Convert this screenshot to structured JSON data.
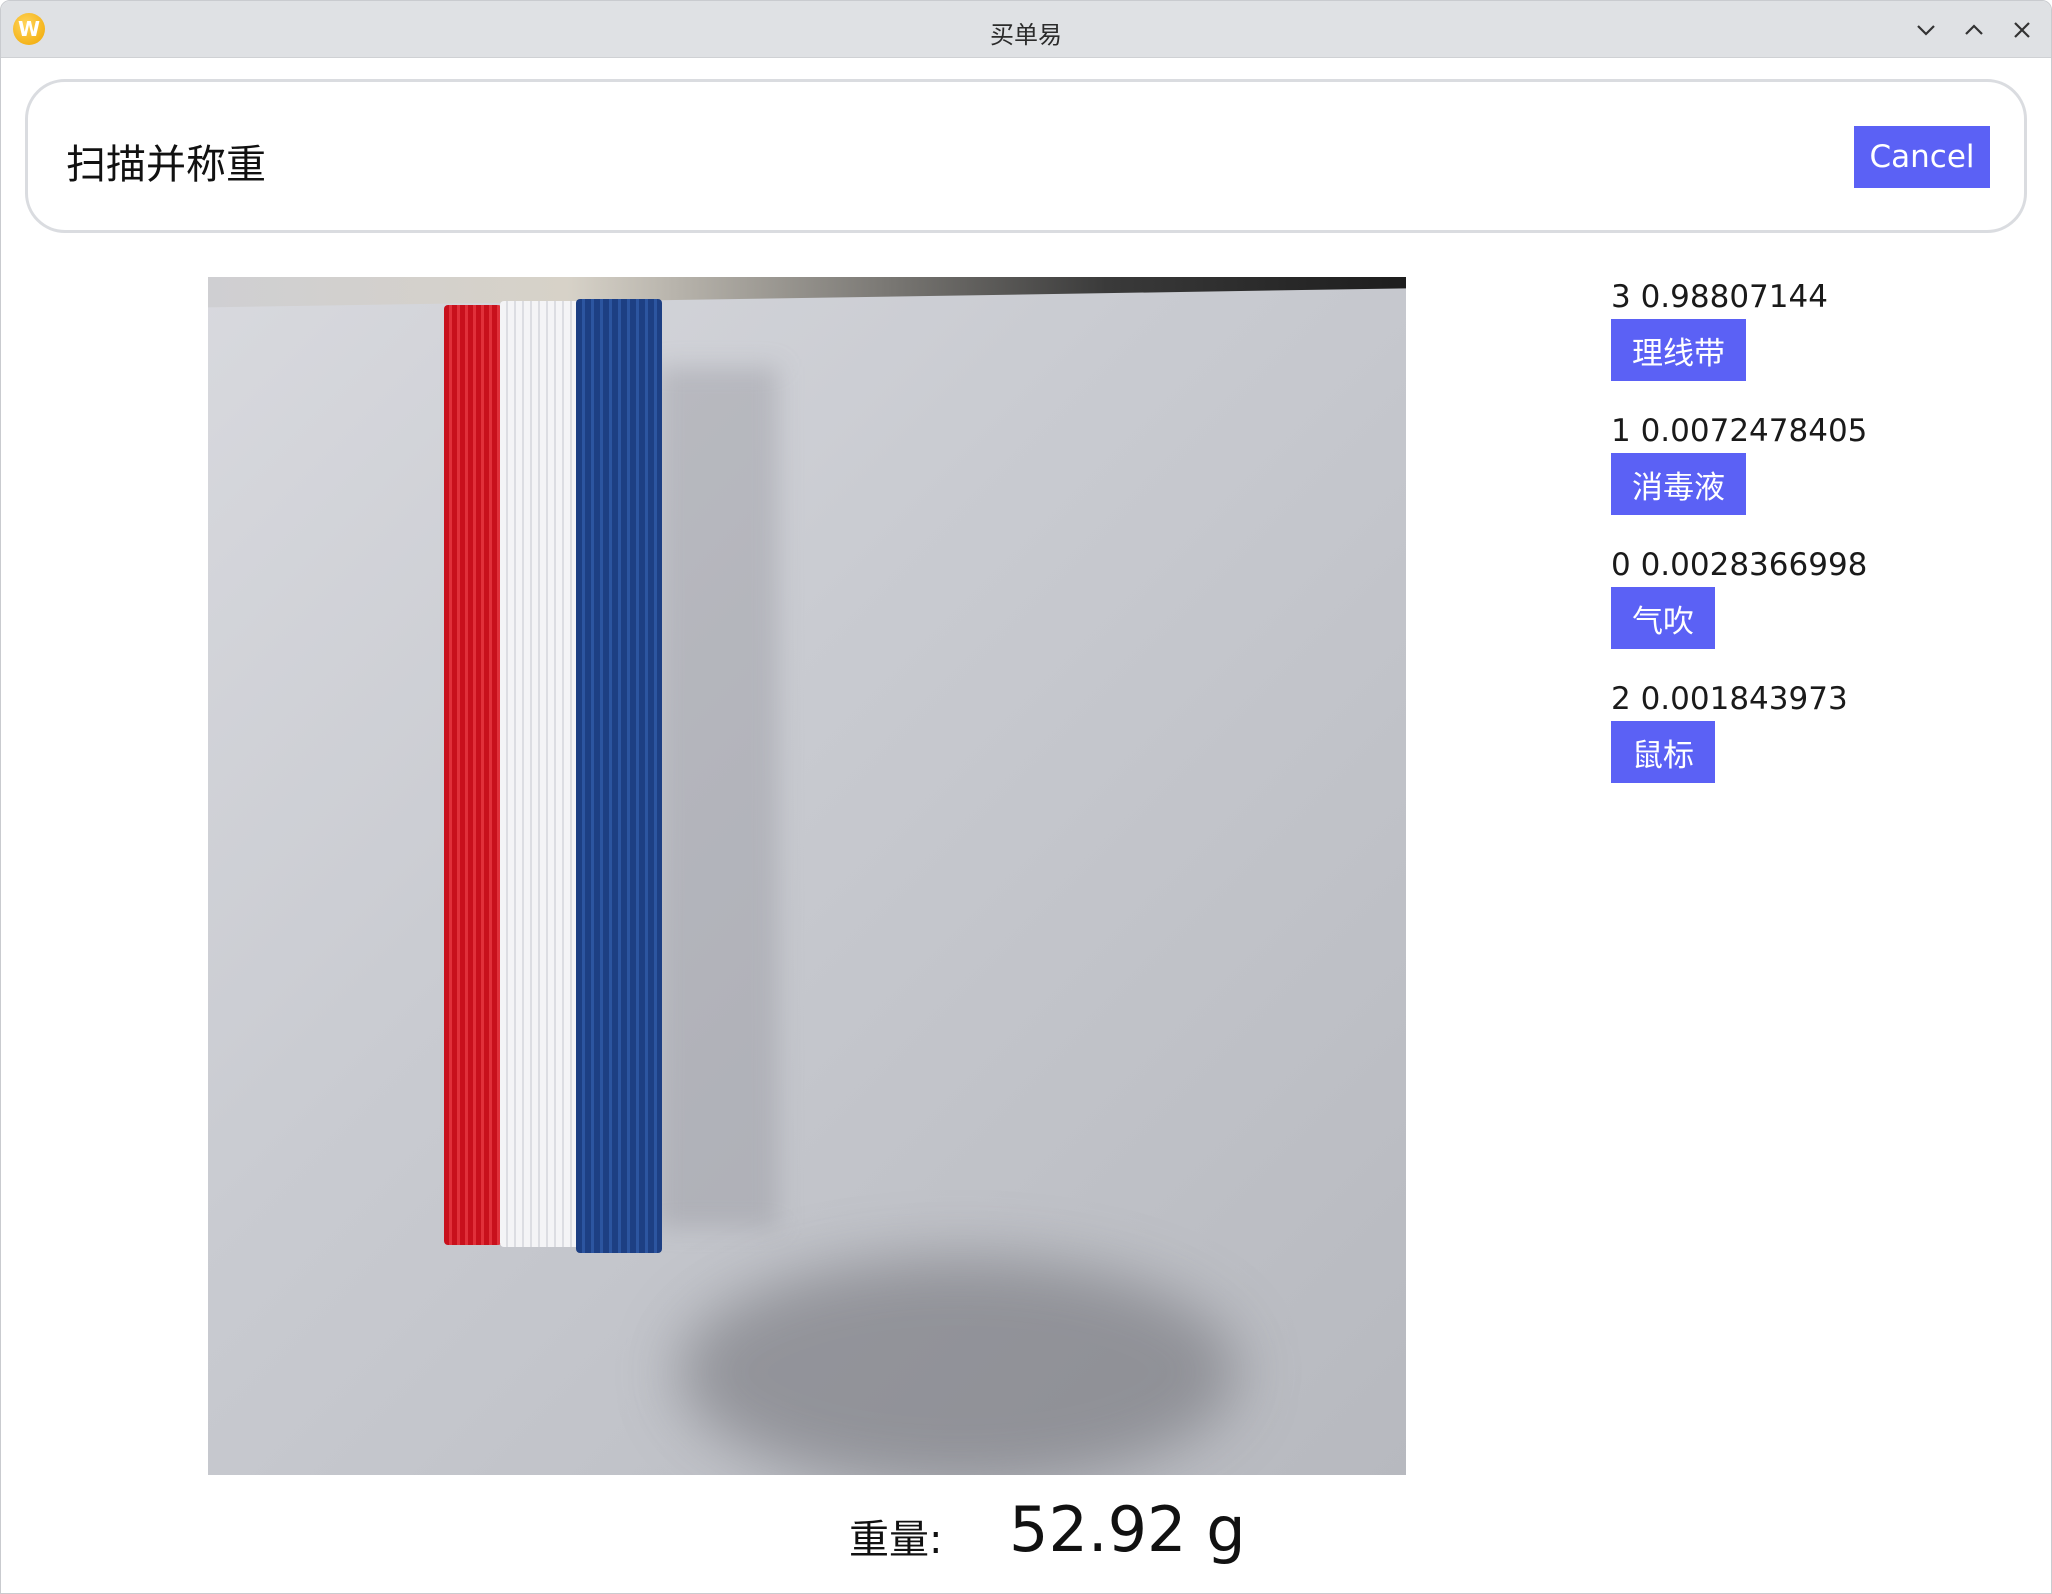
{
  "window": {
    "title": "买单易",
    "logo_letter": "W",
    "controls": [
      "chevron-down-icon",
      "chevron-up-icon",
      "close-icon"
    ]
  },
  "header": {
    "title": "扫描并称重",
    "cancel_label": "Cancel"
  },
  "camera_preview": {
    "description_colors": {
      "strap_red": "#c8101c",
      "strap_white": "#f4f4f6",
      "strap_blue": "#1d3f83"
    }
  },
  "results": [
    {
      "score": "3 0.98807144",
      "label": "理线带"
    },
    {
      "score": "1 0.0072478405",
      "label": "消毒液"
    },
    {
      "score": "0 0.0028366998",
      "label": "气吹"
    },
    {
      "score": "2 0.001843973",
      "label": "鼠标"
    }
  ],
  "weight": {
    "label": "重量:",
    "value": "52.92 g"
  },
  "colors": {
    "accent": "#5b61f5",
    "titlebar": "#dfe1e4"
  }
}
